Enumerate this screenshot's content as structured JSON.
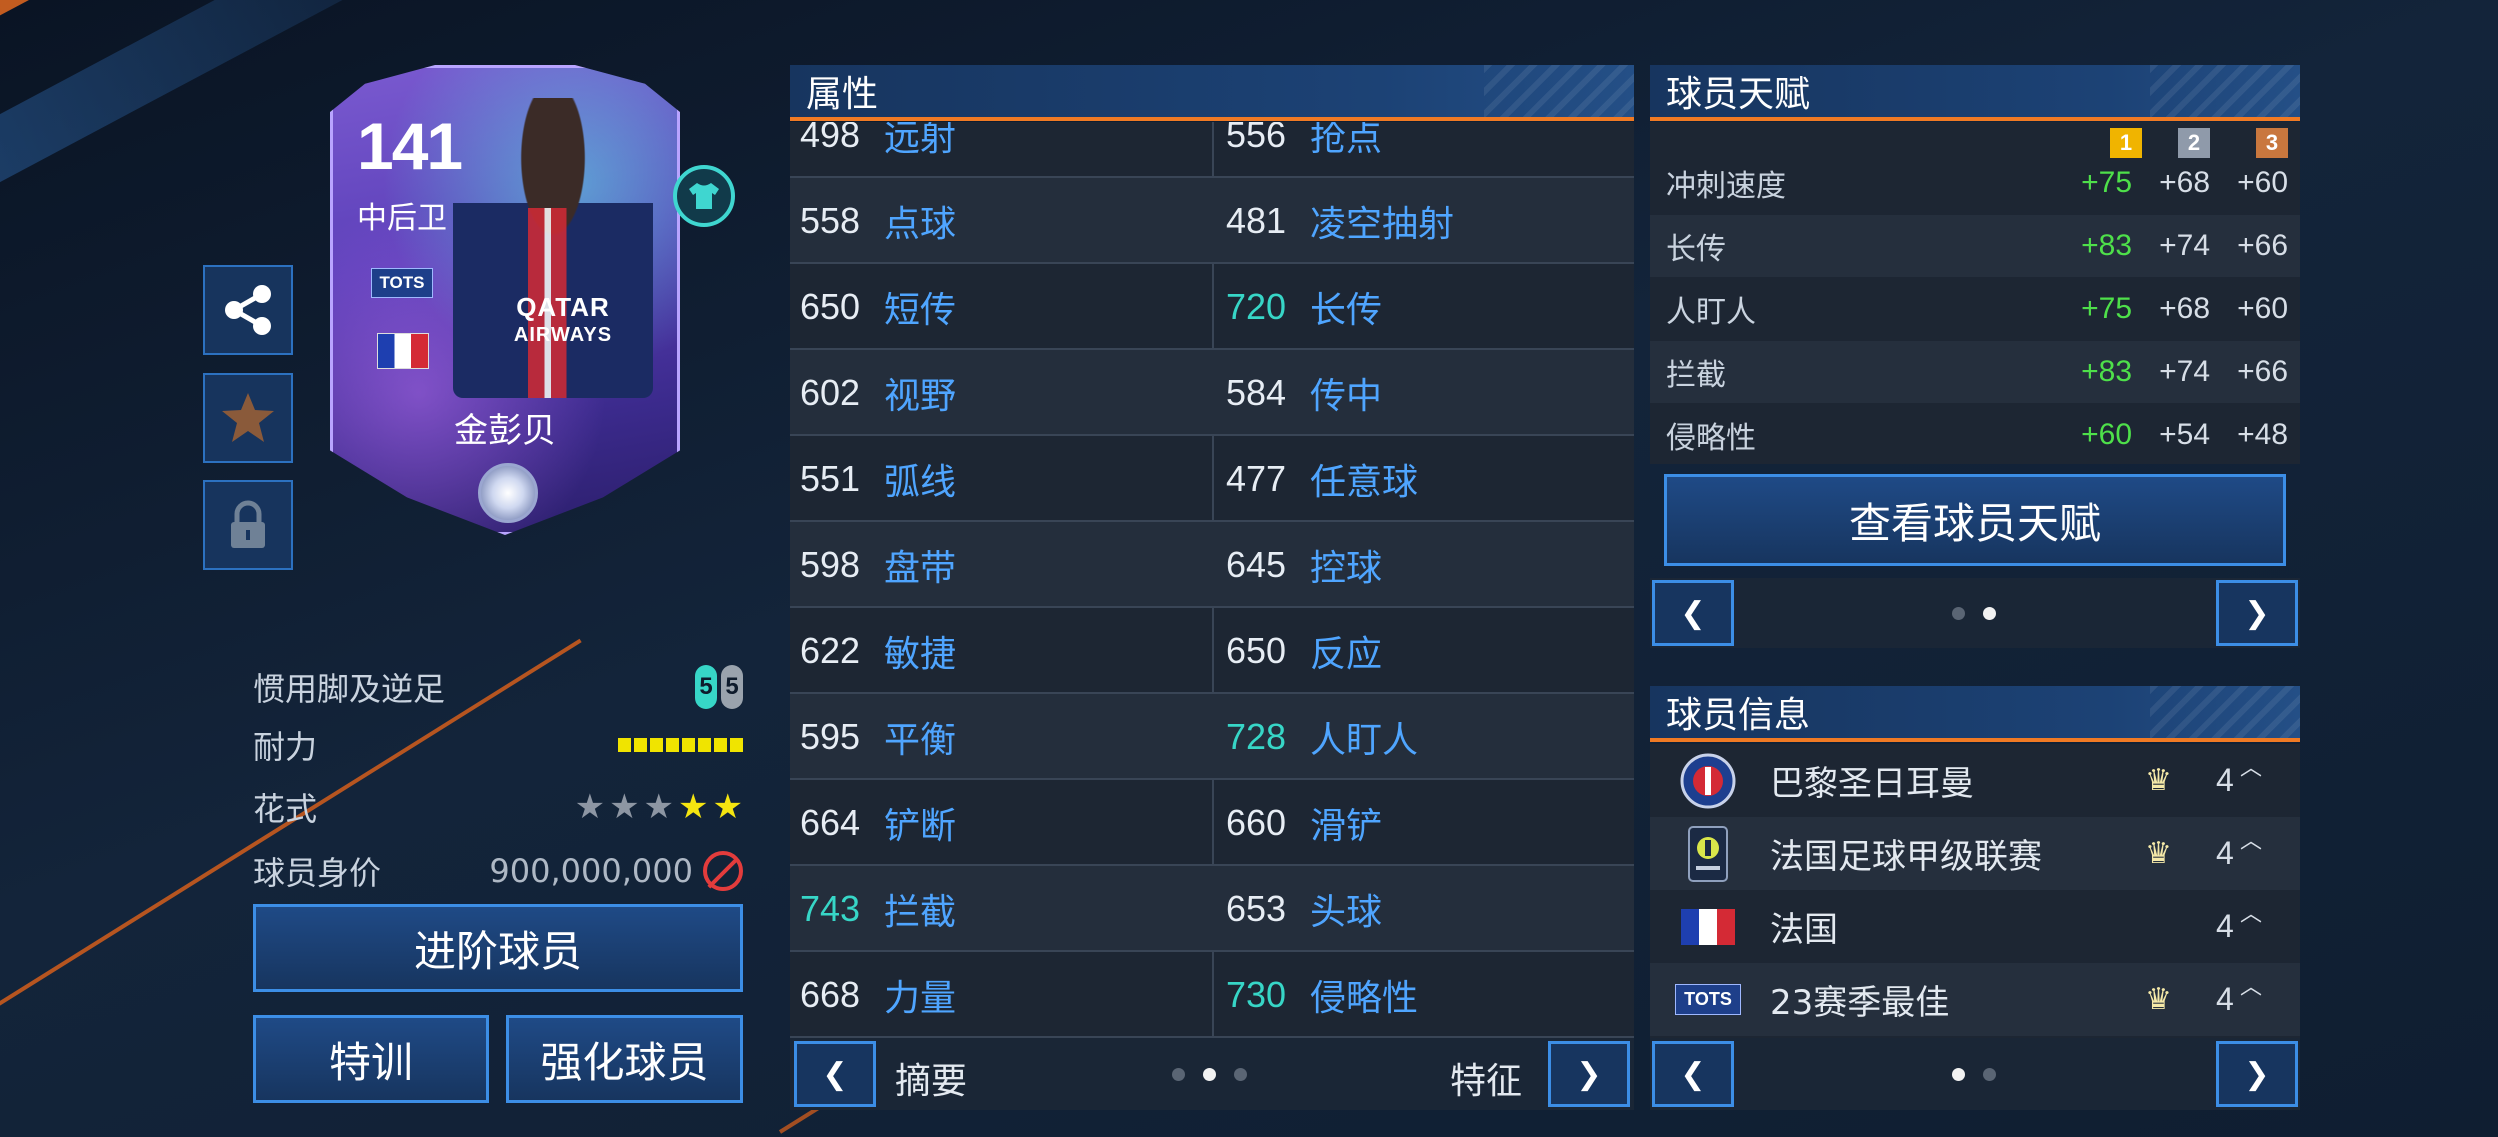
{
  "card": {
    "rating": "141",
    "position": "中后卫",
    "program_badge": "TOTS",
    "name": "金彭贝",
    "sponsor_line1": "QATAR",
    "sponsor_line2": "AIRWAYS",
    "icons": {
      "jersey": "shirt-icon",
      "gem": "diamond-gem-icon",
      "flag": "france-flag-icon"
    }
  },
  "side_buttons": [
    {
      "icon": "share-icon"
    },
    {
      "icon": "star-icon"
    },
    {
      "icon": "lock-icon"
    }
  ],
  "player_info": {
    "foot_label": "惯用脚及逆足",
    "strong_foot": "5",
    "weak_foot": "5",
    "stamina_label": "耐力",
    "stamina_segments": 8,
    "skill_label": "花式",
    "skill_stars_total": 5,
    "skill_stars_filled": 2,
    "value_label": "球员身价",
    "value": "900,000,000"
  },
  "buttons": {
    "upgrade": "进阶球员",
    "training": "特训",
    "enhance": "强化球员"
  },
  "attributes": {
    "title": "属性",
    "rows": [
      {
        "left_val": "498",
        "left_name": "远射",
        "left_hi": false,
        "right_val": "556",
        "right_name": "抢点",
        "right_hi": false
      },
      {
        "left_val": "558",
        "left_name": "点球",
        "left_hi": false,
        "right_val": "481",
        "right_name": "凌空抽射",
        "right_hi": false
      },
      {
        "left_val": "650",
        "left_name": "短传",
        "left_hi": false,
        "right_val": "720",
        "right_name": "长传",
        "right_hi": true
      },
      {
        "left_val": "602",
        "left_name": "视野",
        "left_hi": false,
        "right_val": "584",
        "right_name": "传中",
        "right_hi": false
      },
      {
        "left_val": "551",
        "left_name": "弧线",
        "left_hi": false,
        "right_val": "477",
        "right_name": "任意球",
        "right_hi": false
      },
      {
        "left_val": "598",
        "left_name": "盘带",
        "left_hi": false,
        "right_val": "645",
        "right_name": "控球",
        "right_hi": false
      },
      {
        "left_val": "622",
        "left_name": "敏捷",
        "left_hi": false,
        "right_val": "650",
        "right_name": "反应",
        "right_hi": false
      },
      {
        "left_val": "595",
        "left_name": "平衡",
        "left_hi": false,
        "right_val": "728",
        "right_name": "人盯人",
        "right_hi": true
      },
      {
        "left_val": "664",
        "left_name": "铲断",
        "left_hi": false,
        "right_val": "660",
        "right_name": "滑铲",
        "right_hi": false
      },
      {
        "left_val": "743",
        "left_name": "拦截",
        "left_hi": true,
        "right_val": "653",
        "right_name": "头球",
        "right_hi": false
      },
      {
        "left_val": "668",
        "left_name": "力量",
        "left_hi": false,
        "right_val": "730",
        "right_name": "侵略性",
        "right_hi": true
      }
    ],
    "prev_label": "摘要",
    "next_label": "特征",
    "page_count": 3,
    "active_page": 1
  },
  "traits": {
    "title": "球员天赋",
    "ranks": [
      "1",
      "2",
      "3"
    ],
    "rank_colors": [
      "#f0b400",
      "#8f9aaa",
      "#c9773e"
    ],
    "rows": [
      {
        "name": "冲刺速度",
        "v1": "+75",
        "v2": "+68",
        "v3": "+60"
      },
      {
        "name": "长传",
        "v1": "+83",
        "v2": "+74",
        "v3": "+66"
      },
      {
        "name": "人盯人",
        "v1": "+75",
        "v2": "+68",
        "v3": "+60"
      },
      {
        "name": "拦截",
        "v1": "+83",
        "v2": "+74",
        "v3": "+66"
      },
      {
        "name": "侵略性",
        "v1": "+60",
        "v2": "+54",
        "v3": "+48"
      }
    ],
    "view_button": "查看球员天赋",
    "page_count": 2,
    "active_page": 1
  },
  "info": {
    "title": "球员信息",
    "rows": [
      {
        "icon": "psg-crest-icon",
        "label": "巴黎圣日耳曼",
        "crown": true,
        "rating": "4"
      },
      {
        "icon": "ligue1-logo-icon",
        "label": "法国足球甲级联赛",
        "crown": true,
        "rating": "4"
      },
      {
        "icon": "france-flag-icon",
        "label": "法国",
        "crown": false,
        "rating": "4"
      },
      {
        "icon": "tots-badge-icon",
        "label": "23赛季最佳",
        "crown": true,
        "rating": "4"
      }
    ],
    "tots_text": "TOTS",
    "page_count": 2,
    "active_page": 0
  },
  "colors": {
    "accent_orange": "#f07a24",
    "highlight_teal": "#37d6c7",
    "attr_blue": "#4fa5ff",
    "bonus_green": "#4ee04a"
  }
}
